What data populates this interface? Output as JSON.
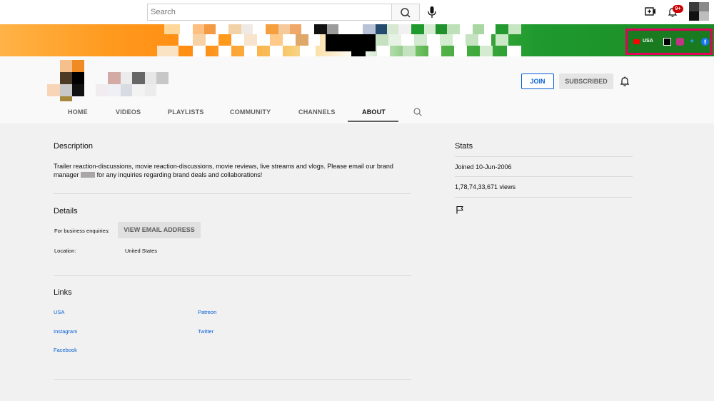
{
  "header": {
    "search_placeholder": "Search",
    "notification_count": "9+",
    "icons": [
      "search-icon",
      "mic-icon",
      "create-video-icon",
      "bell-icon",
      "avatar"
    ]
  },
  "banner": {
    "links_label": "USA",
    "social_icons": [
      "youtube-icon",
      "patreon-icon",
      "instagram-icon",
      "twitter-icon",
      "facebook-icon"
    ],
    "highlight_color": "#e4005a"
  },
  "channel": {
    "join_label": "JOIN",
    "subscribed_label": "SUBSCRIBED"
  },
  "tabs": [
    {
      "label": "HOME"
    },
    {
      "label": "VIDEOS"
    },
    {
      "label": "PLAYLISTS"
    },
    {
      "label": "COMMUNITY"
    },
    {
      "label": "CHANNELS"
    },
    {
      "label": "ABOUT",
      "active": true
    }
  ],
  "about": {
    "description_heading": "Description",
    "description_line1": "Trailer reaction-discussions, movie reaction-discussions, movie reviews, live streams and vlogs.  Please email our brand",
    "description_line2_a": "manager",
    "description_line2_b": "for any inquiries regarding brand deals and collaborations!",
    "details_heading": "Details",
    "business_label": "For business enquiries:",
    "email_button": "VIEW EMAIL ADDRESS",
    "location_label": "Location:",
    "location_value": "United States",
    "links_heading": "Links",
    "links": [
      {
        "label": "USA"
      },
      {
        "label": "Patreon"
      },
      {
        "label": "Instagram"
      },
      {
        "label": "Twitter"
      },
      {
        "label": "Facebook"
      }
    ]
  },
  "stats": {
    "heading": "Stats",
    "joined": "Joined 10-Jun-2006",
    "views": "1,78,74,33,671 views"
  },
  "colors": {
    "link": "#065fd4",
    "badge": "#cc0000"
  }
}
